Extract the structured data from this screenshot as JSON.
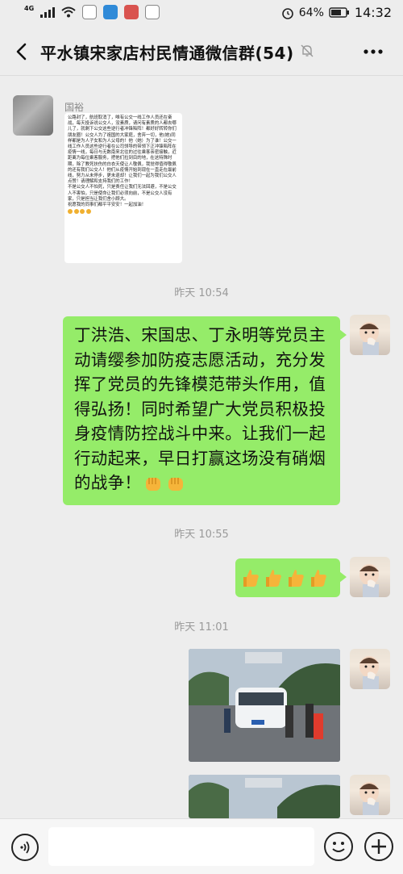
{
  "status_bar": {
    "network": "4G",
    "battery": "64%",
    "time": "14:32"
  },
  "header": {
    "title": "平水镇宋家店村民情通微信群(54)",
    "back_icon": "chevron-left-icon",
    "mute_icon": "bell-off-icon",
    "more_icon": "more-dots-icon"
  },
  "messages": {
    "first": {
      "sender": "国裕",
      "image_text": "公路封了，航班取消了，唯有公交一线工作人员还在奋战，每天投诉说公交人，没素质，请问有素质的人都去哪儿了，就剩下公交这些逆行者冲锋陷阵！都好好转转你们朋友圈！公交人为了祖国的大家庭，舍弃一切，他(她)同样都是为人子女和为人父母的！他（她）为了谁！公交一线工作人员这些逆行者在公司领导的带领下正冲锋陷阵在疫情一线，每日与无数南来北往的过往乘客亲密接触，近距离为每位乘客服务，把他们拉到目的地，在这特殊时期，除了教死扶伤的白衣天使让人敬佩，我觉得值得敬佩的还有我们公交人！他们从疫情开始到现在一直走在最前线，努力从未停步，更未退却！让我们一起为我们公交人点赞！请理解和支持我们的工作！\n不是公交人不怕死，只是责任让我们无法回避，不是公交人不害怕，只是使命让我们必须向前，不是公交人没有家，只是担当让我们舍小顾大。\n祝愿我的同事们都平平安安！一起加油！"
    },
    "ts1": "昨天 10:54",
    "long_text": "丁洪浩、宋国忠、丁永明等党员主动请缨参加防疫志愿活动，充分发挥了党员的先锋模范带头作用，值得弘扬！同时希望广大党员积极投身疫情防控战斗中来。让我们一起行动起来，早日打赢这场没有硝烟的战争！",
    "long_text_emoji": "fist-emoji",
    "ts2": "昨天 10:55",
    "thumbs_emoji": "thumbs-up-emoji",
    "ts3": "昨天 11:01",
    "photo_icon": "checkpoint-photo"
  },
  "input": {
    "placeholder": "",
    "voice_icon": "voice-icon",
    "emoji_icon": "smiley-icon",
    "plus_icon": "plus-icon"
  }
}
